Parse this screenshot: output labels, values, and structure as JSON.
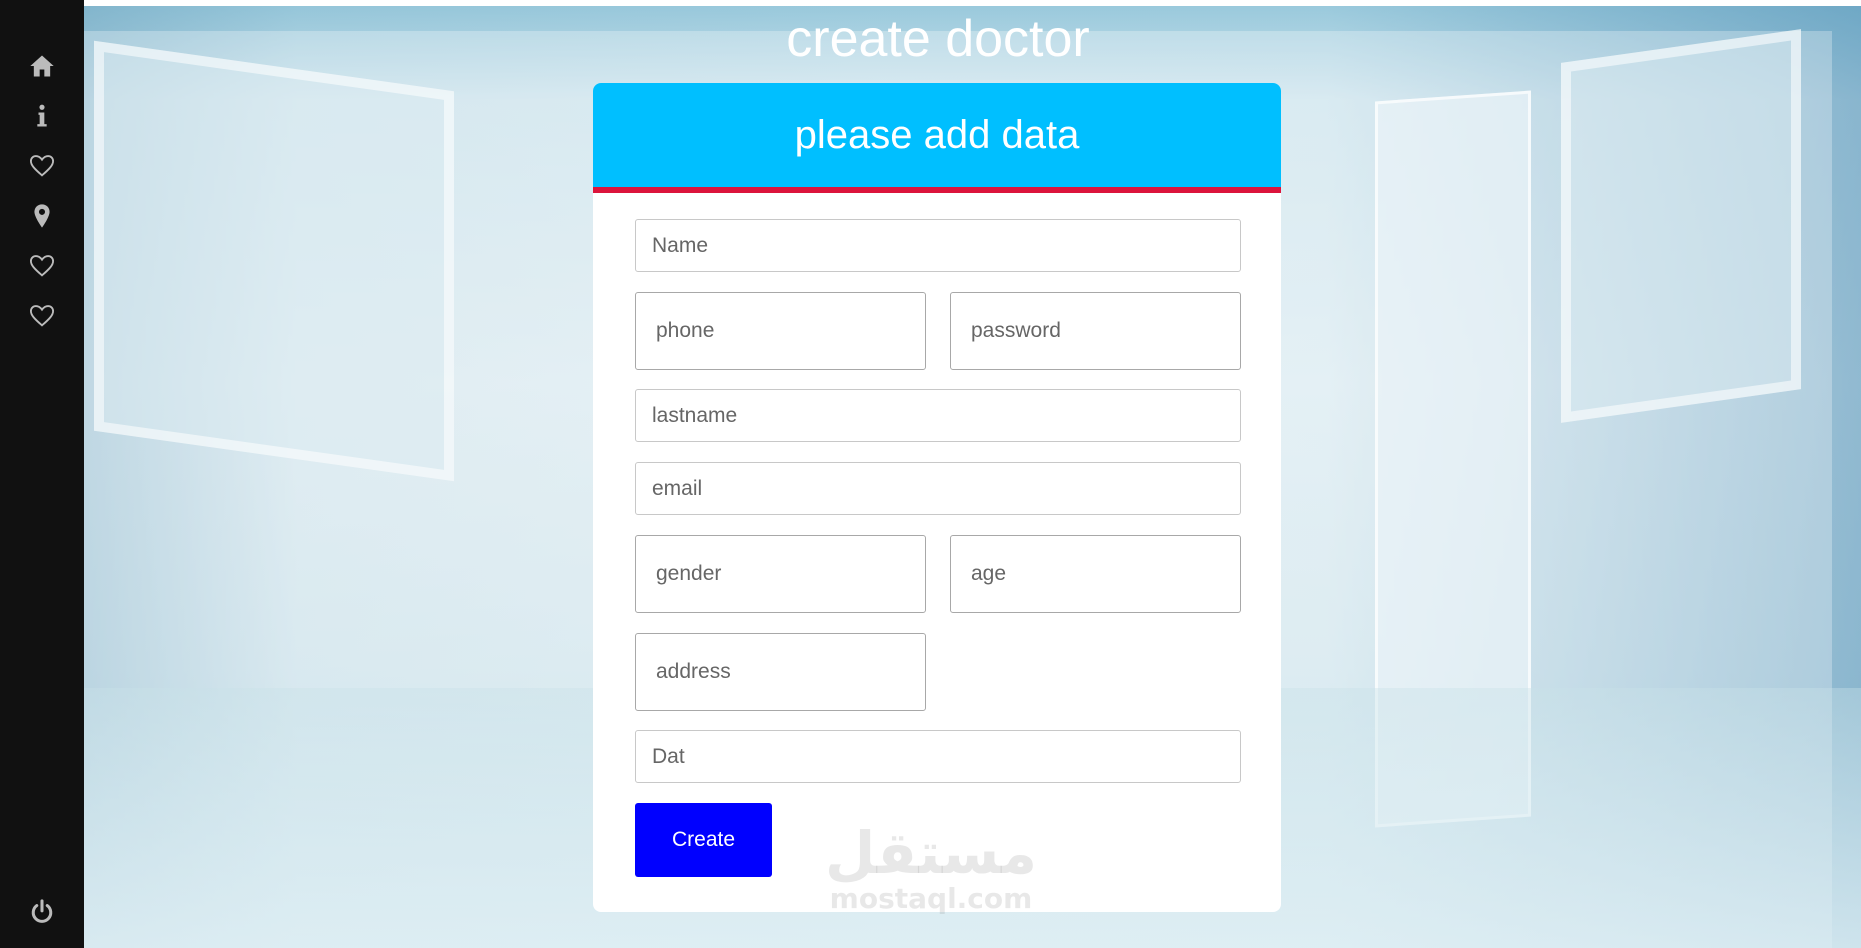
{
  "page": {
    "title": "create doctor"
  },
  "sidebar": {
    "items": [
      {
        "icon": "home-icon"
      },
      {
        "icon": "info-icon"
      },
      {
        "icon": "heart-icon"
      },
      {
        "icon": "map-pin-icon"
      },
      {
        "icon": "heart-icon"
      },
      {
        "icon": "heart-icon"
      }
    ],
    "logout_icon": "power-icon"
  },
  "form": {
    "header": "please add data",
    "fields": {
      "name": {
        "placeholder": "Name",
        "value": ""
      },
      "phone": {
        "placeholder": "phone",
        "value": ""
      },
      "password": {
        "placeholder": "password",
        "value": ""
      },
      "lastname": {
        "placeholder": "lastname",
        "value": ""
      },
      "email": {
        "placeholder": "email",
        "value": ""
      },
      "gender": {
        "placeholder": "gender",
        "value": ""
      },
      "age": {
        "placeholder": "age",
        "value": ""
      },
      "address": {
        "placeholder": "address",
        "value": ""
      },
      "date": {
        "placeholder": "Dat",
        "value": ""
      }
    },
    "submit_label": "Create"
  },
  "watermark": {
    "arabic": "مستقل",
    "latin": "mostaql.com"
  },
  "colors": {
    "sidebar_bg": "#111111",
    "header_bg": "#00bfff",
    "header_border": "#dc143c",
    "button_bg": "#0000ff",
    "icon_color": "#bbbbbb"
  }
}
